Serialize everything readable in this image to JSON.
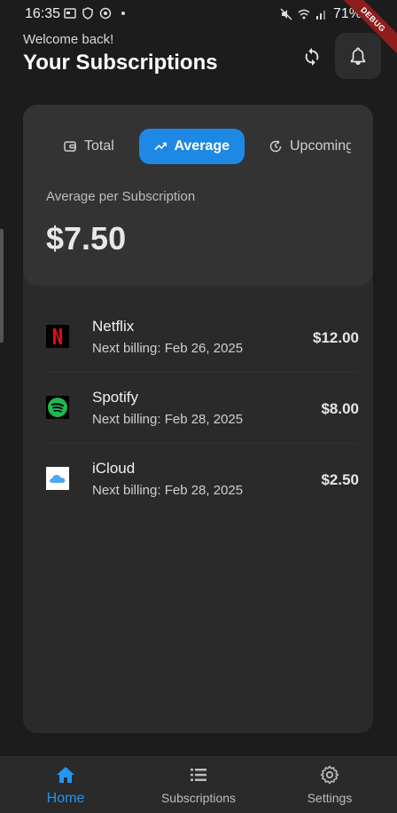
{
  "status": {
    "time": "16:35",
    "battery": "71%"
  },
  "debug_label": "DEBUG",
  "header": {
    "welcome": "Welcome back!",
    "title": "Your Subscriptions"
  },
  "tabs": [
    {
      "label": "Total",
      "icon": "wallet-icon",
      "selected": false
    },
    {
      "label": "Average",
      "icon": "trending-up-icon",
      "selected": true
    },
    {
      "label": "Upcoming",
      "icon": "history-icon",
      "selected": false
    }
  ],
  "summary": {
    "label": "Average per Subscription",
    "value": "$7.50"
  },
  "subscriptions": [
    {
      "name": "Netflix",
      "date": "Next billing: Feb 26, 2025",
      "price": "$12.00",
      "logo": "netflix-logo"
    },
    {
      "name": "Spotify",
      "date": "Next billing: Feb 28, 2025",
      "price": "$8.00",
      "logo": "spotify-logo"
    },
    {
      "name": "iCloud",
      "date": "Next billing: Feb 28, 2025",
      "price": "$2.50",
      "logo": "icloud-logo"
    }
  ],
  "nav": [
    {
      "label": "Home",
      "icon": "home-icon",
      "active": true
    },
    {
      "label": "Subscriptions",
      "icon": "list-icon",
      "active": false
    },
    {
      "label": "Settings",
      "icon": "gear-icon",
      "active": false
    }
  ],
  "colors": {
    "accent": "#1e88e5",
    "background": "#1c1c1c",
    "card": "#2a2a2a",
    "summary_card": "#333333"
  }
}
